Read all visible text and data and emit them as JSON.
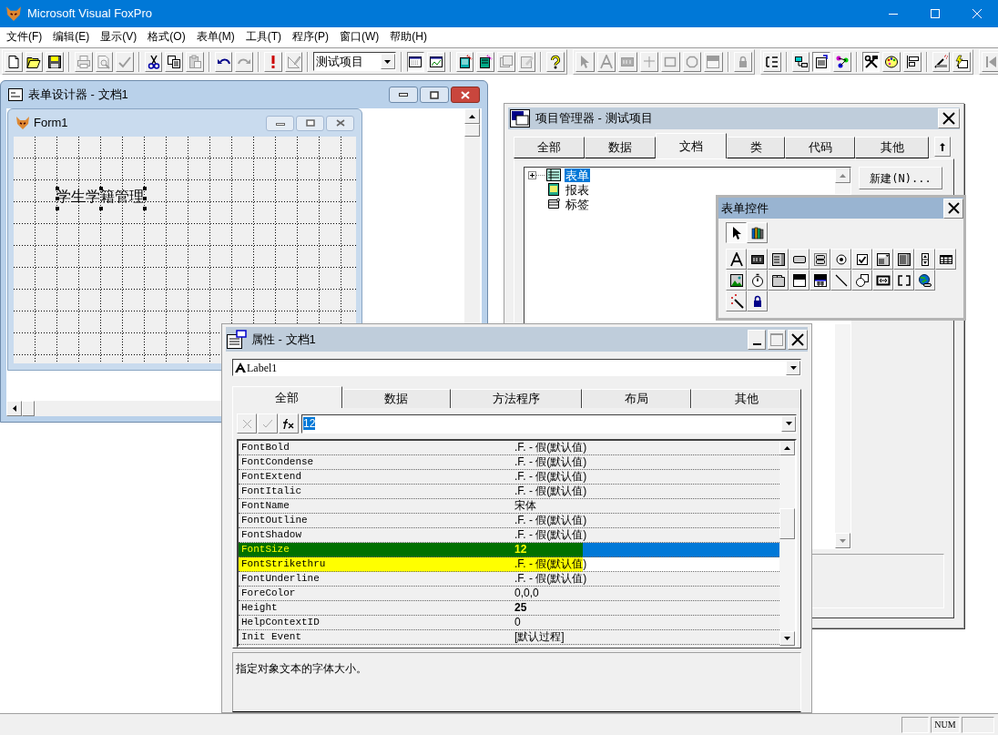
{
  "app": {
    "title": "Microsoft Visual FoxPro"
  },
  "menu": [
    "文件(F)",
    "编辑(E)",
    "显示(V)",
    "格式(O)",
    "表单(M)",
    "工具(T)",
    "程序(P)",
    "窗口(W)",
    "帮助(H)"
  ],
  "toolbars": [
    {
      "items": [
        {
          "kind": "button",
          "disabled": false,
          "pressed": false
        },
        {
          "kind": "button",
          "disabled": false,
          "pressed": false
        },
        {
          "kind": "button",
          "disabled": false,
          "pressed": false
        },
        {
          "kind": "separator"
        },
        {
          "kind": "button",
          "disabled": true,
          "pressed": false
        },
        {
          "kind": "button",
          "disabled": true,
          "pressed": false
        },
        {
          "kind": "button",
          "disabled": true,
          "pressed": false
        },
        {
          "kind": "separator"
        },
        {
          "kind": "button",
          "disabled": false,
          "pressed": false
        },
        {
          "kind": "button",
          "disabled": false,
          "pressed": false
        },
        {
          "kind": "button",
          "disabled": true,
          "pressed": false
        },
        {
          "kind": "separator"
        },
        {
          "kind": "button",
          "disabled": false,
          "pressed": false
        },
        {
          "kind": "button",
          "disabled": true,
          "pressed": false
        },
        {
          "kind": "separator"
        },
        {
          "kind": "button",
          "disabled": false,
          "pressed": false
        },
        {
          "kind": "button",
          "disabled": true,
          "pressed": false
        },
        {
          "kind": "separator"
        },
        {
          "kind": "combo",
          "value": "测试项目"
        },
        {
          "kind": "separator"
        },
        {
          "kind": "button",
          "disabled": false,
          "pressed": true
        },
        {
          "kind": "button",
          "disabled": false,
          "pressed": false
        },
        {
          "kind": "separator"
        },
        {
          "kind": "button",
          "disabled": false,
          "pressed": false
        },
        {
          "kind": "button",
          "disabled": false,
          "pressed": false
        },
        {
          "kind": "button",
          "disabled": true,
          "pressed": false
        },
        {
          "kind": "button",
          "disabled": true,
          "pressed": false
        },
        {
          "kind": "separator"
        },
        {
          "kind": "button",
          "disabled": false,
          "pressed": false
        }
      ]
    },
    {
      "items": [
        {
          "kind": "button",
          "disabled": true,
          "pressed": false
        },
        {
          "kind": "button",
          "disabled": true,
          "pressed": false
        },
        {
          "kind": "button",
          "disabled": true,
          "pressed": false
        },
        {
          "kind": "button",
          "disabled": true,
          "pressed": false
        },
        {
          "kind": "button",
          "disabled": true,
          "pressed": false
        },
        {
          "kind": "button",
          "disabled": true,
          "pressed": false
        },
        {
          "kind": "button",
          "disabled": true,
          "pressed": false
        },
        {
          "kind": "separator"
        },
        {
          "kind": "button",
          "disabled": true,
          "pressed": false
        }
      ]
    },
    {
      "items": [
        {
          "kind": "button",
          "disabled": false,
          "pressed": false
        },
        {
          "kind": "separator"
        },
        {
          "kind": "button",
          "disabled": false,
          "pressed": false
        },
        {
          "kind": "button",
          "disabled": false,
          "pressed": true
        },
        {
          "kind": "button",
          "disabled": false,
          "pressed": false
        },
        {
          "kind": "separator"
        },
        {
          "kind": "button",
          "disabled": false,
          "pressed": true
        },
        {
          "kind": "button",
          "disabled": false,
          "pressed": false
        },
        {
          "kind": "button",
          "disabled": false,
          "pressed": false
        },
        {
          "kind": "separator"
        },
        {
          "kind": "button",
          "disabled": false,
          "pressed": false
        },
        {
          "kind": "button",
          "disabled": false,
          "pressed": false
        }
      ]
    },
    {
      "items": [
        {
          "kind": "button",
          "disabled": true,
          "pressed": false
        }
      ]
    }
  ],
  "form_designer": {
    "title": "表单设计器 - 文档1",
    "form": {
      "title": "Form1",
      "label": {
        "text": "学生学籍管理",
        "selected": true
      }
    }
  },
  "project_manager": {
    "title": "项目管理器 - 测试项目",
    "tabs": [
      {
        "label": "全部",
        "selected": false
      },
      {
        "label": "数据",
        "selected": false
      },
      {
        "label": "文档",
        "selected": true
      },
      {
        "label": "类",
        "selected": false
      },
      {
        "label": "代码",
        "selected": false
      },
      {
        "label": "其他",
        "selected": false
      }
    ],
    "tree": [
      {
        "label": "表单",
        "selected": true,
        "has_children": true
      },
      {
        "label": "报表",
        "selected": false,
        "has_children": false
      },
      {
        "label": "标签",
        "selected": false,
        "has_children": false
      }
    ],
    "buttons": [
      "新建(N)..."
    ]
  },
  "form_controls": {
    "title": "表单控件",
    "rows": [
      [
        {
          "pressed": true
        },
        {
          "pressed": false
        }
      ],
      [
        {
          "pressed": false
        },
        {
          "pressed": false
        },
        {
          "pressed": false
        },
        {
          "pressed": false
        },
        {
          "pressed": false
        },
        {
          "pressed": false
        },
        {
          "pressed": false
        },
        {
          "pressed": false
        },
        {
          "pressed": false
        },
        {
          "pressed": false
        },
        {
          "pressed": false
        }
      ],
      [
        {
          "pressed": false
        },
        {
          "pressed": false
        },
        {
          "pressed": false
        },
        {
          "pressed": false
        },
        {
          "pressed": false
        },
        {
          "pressed": false
        },
        {
          "pressed": false
        },
        {
          "pressed": false
        },
        {
          "pressed": false
        },
        {
          "pressed": false
        }
      ],
      [
        {
          "pressed": false
        },
        {
          "pressed": false
        }
      ]
    ]
  },
  "properties": {
    "title": "属性 - 文档1",
    "object": "Label1",
    "tabs": [
      {
        "label": "全部",
        "selected": true
      },
      {
        "label": "数据",
        "selected": false
      },
      {
        "label": "方法程序",
        "selected": false
      },
      {
        "label": "布局",
        "selected": false
      },
      {
        "label": "其他",
        "selected": false
      }
    ],
    "edit_value": "12",
    "rows": [
      {
        "name": "FontBold",
        "value": ".F. - 假(默认值)",
        "bold": false,
        "selected": false,
        "highlighted": false
      },
      {
        "name": "FontCondense",
        "value": ".F. - 假(默认值)",
        "bold": false,
        "selected": false,
        "highlighted": false
      },
      {
        "name": "FontExtend",
        "value": ".F. - 假(默认值)",
        "bold": false,
        "selected": false,
        "highlighted": false
      },
      {
        "name": "FontItalic",
        "value": ".F. - 假(默认值)",
        "bold": false,
        "selected": false,
        "highlighted": false
      },
      {
        "name": "FontName",
        "value": "宋体",
        "bold": false,
        "selected": false,
        "highlighted": false
      },
      {
        "name": "FontOutline",
        "value": ".F. - 假(默认值)",
        "bold": false,
        "selected": false,
        "highlighted": false
      },
      {
        "name": "FontShadow",
        "value": ".F. - 假(默认值)",
        "bold": false,
        "selected": false,
        "highlighted": false
      },
      {
        "name": "FontSize",
        "value": "12",
        "bold": true,
        "selected": true,
        "highlighted": true
      },
      {
        "name": "FontStrikethru",
        "value": ".F. - 假(默认值)",
        "bold": false,
        "selected": false,
        "highlighted": true
      },
      {
        "name": "FontUnderline",
        "value": ".F. - 假(默认值)",
        "bold": false,
        "selected": false,
        "highlighted": false
      },
      {
        "name": "ForeColor",
        "value": "0,0,0",
        "bold": false,
        "selected": false,
        "highlighted": false
      },
      {
        "name": "Height",
        "value": "25",
        "bold": true,
        "selected": false,
        "highlighted": false
      },
      {
        "name": "HelpContextID",
        "value": "0",
        "bold": false,
        "selected": false,
        "highlighted": false
      },
      {
        "name": "Init Event",
        "value": "[默认过程]",
        "bold": false,
        "selected": false,
        "highlighted": false
      }
    ],
    "description": "指定对象文本的字体大小。"
  },
  "status_bar": {
    "indicators": [
      "NUM"
    ]
  }
}
